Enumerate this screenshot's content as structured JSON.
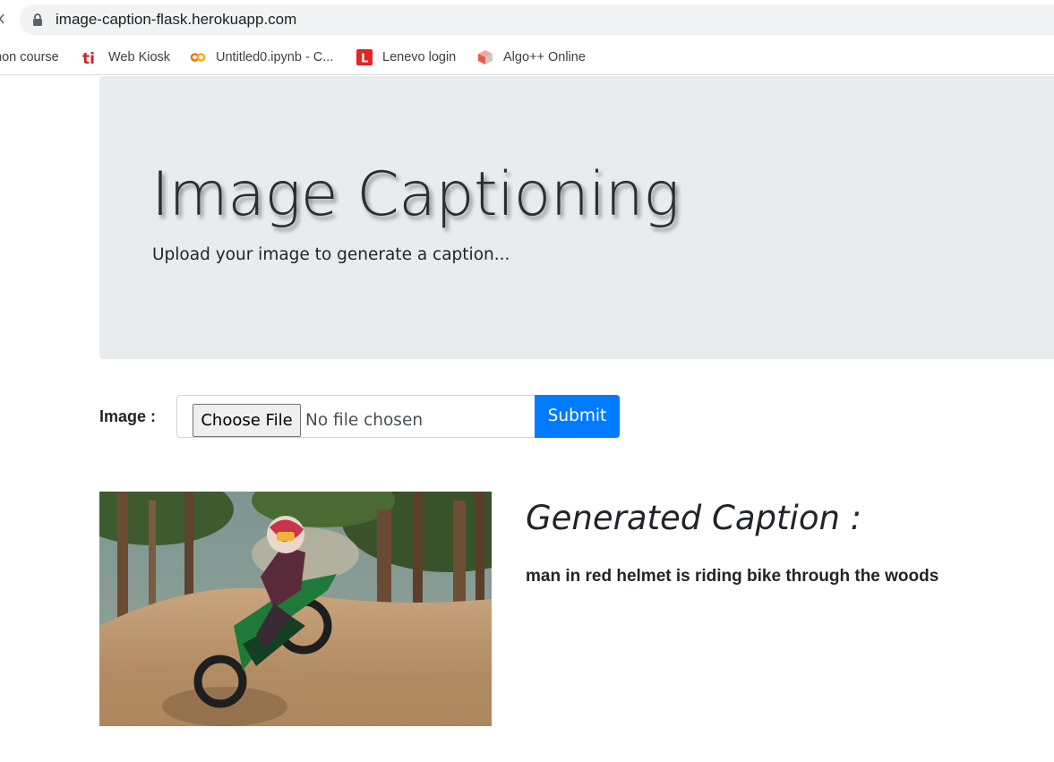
{
  "browser": {
    "url": "image-caption-flask.herokuapp.com",
    "bookmarks": [
      {
        "label": "non course",
        "icon": "none"
      },
      {
        "label": "Web Kiosk",
        "icon": "ti-logo-icon"
      },
      {
        "label": "Untitled0.ipynb - C...",
        "icon": "colab-icon"
      },
      {
        "label": "Lenevo login",
        "icon": "l-logo-icon"
      },
      {
        "label": "Algo++ Online",
        "icon": "algo-cube-icon"
      }
    ],
    "colors": {
      "bar": "#ffffff",
      "omnibox": "#f1f3f4"
    }
  },
  "header": {
    "title": "Image Captioning",
    "subtitle": "Upload your image to generate a caption..."
  },
  "form": {
    "label": "Image :",
    "choose_file_label": "Choose File",
    "no_file_text": "No file chosen",
    "submit_label": "Submit"
  },
  "result": {
    "image_subject": "motocross rider on dirt bike",
    "heading": "Generated Caption :",
    "caption": "man in red helmet is riding bike through the woods"
  },
  "colors": {
    "jumbotron": "#e9ecef",
    "primary": "#007bff",
    "text": "#212529"
  }
}
